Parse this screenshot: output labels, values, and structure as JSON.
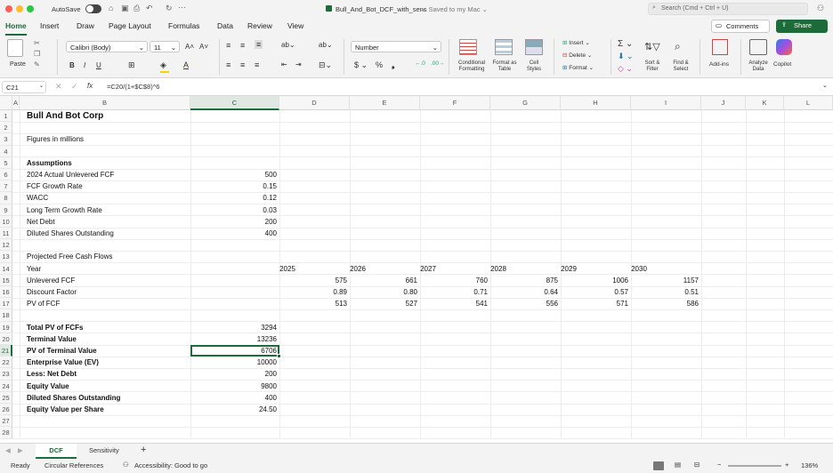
{
  "titlebar": {
    "autosave_label": "AutoSave",
    "file_title": "Bull_And_Bot_DCF_with_sens",
    "saved_status": "— Saved to my Mac ⌄",
    "search_placeholder": "Search (Cmd + Ctrl + U)"
  },
  "tabs": [
    "Home",
    "Insert",
    "Draw",
    "Page Layout",
    "Formulas",
    "Data",
    "Review",
    "View"
  ],
  "ribbon": {
    "comments": "Comments",
    "share": "Share",
    "paste": "Paste",
    "font_name": "Calibri (Body)",
    "font_size": "11",
    "number_format": "Number",
    "conditional_formatting": "Conditional Formatting",
    "format_as_table": "Format as Table",
    "cell_styles": "Cell Styles",
    "insert": "Insert",
    "delete": "Delete",
    "format": "Format",
    "sort_filter": "Sort & Filter",
    "find_select": "Find & Select",
    "addins": "Add-ins",
    "analyze_data": "Analyze Data",
    "copilot": "Copilot"
  },
  "formula_bar": {
    "name_box": "C21",
    "formula": "=C20/(1+$C$8)^6"
  },
  "columns": [
    "A",
    "B",
    "C",
    "D",
    "E",
    "F",
    "G",
    "H",
    "I",
    "J",
    "K",
    "L"
  ],
  "rows": [
    "1",
    "2",
    "3",
    "4",
    "5",
    "6",
    "7",
    "8",
    "9",
    "10",
    "11",
    "12",
    "13",
    "14",
    "15",
    "16",
    "17",
    "18",
    "19",
    "20",
    "21",
    "22",
    "23",
    "24",
    "25",
    "26",
    "27",
    "28"
  ],
  "cells": {
    "title": "Bull And Bot Corp",
    "figures": "Figures in millions",
    "assumptions": "Assumptions",
    "a_labels": [
      "2024 Actual Unlevered FCF",
      "FCF Growth Rate",
      "WACC",
      "Long Term Growth Rate",
      "Net Debt",
      "Diluted Shares Outstanding"
    ],
    "a_values": [
      "500",
      "0.15",
      "0.12",
      "0.03",
      "200",
      "400"
    ],
    "projected": "Projected Free Cash Flows",
    "year_label": "Year",
    "years": [
      "2025",
      "2026",
      "2027",
      "2028",
      "2029",
      "2030"
    ],
    "ufcf_label": "Unlevered FCF",
    "ufcf": [
      "575",
      "661",
      "760",
      "875",
      "1006",
      "1157"
    ],
    "df_label": "Discount Factor",
    "df": [
      "0.89",
      "0.80",
      "0.71",
      "0.64",
      "0.57",
      "0.51"
    ],
    "pv_label": "PV of FCF",
    "pv": [
      "513",
      "527",
      "541",
      "556",
      "571",
      "586"
    ],
    "s_labels": [
      "Total PV of FCFs",
      "Terminal Value",
      "PV of Terminal Value",
      "Enterprise Value (EV)",
      "Less: Net Debt",
      "Equity Value",
      "Diluted Shares Outstanding",
      "Equity Value per Share"
    ],
    "s_values": [
      "3294",
      "13236",
      "6706",
      "10000",
      "200",
      "9800",
      "400",
      "24.50"
    ]
  },
  "sheets": [
    "DCF",
    "Sensitivity"
  ],
  "status": {
    "ready": "Ready",
    "circular": "Circular References",
    "accessibility": "Accessibility: Good to go",
    "zoom": "136%"
  }
}
